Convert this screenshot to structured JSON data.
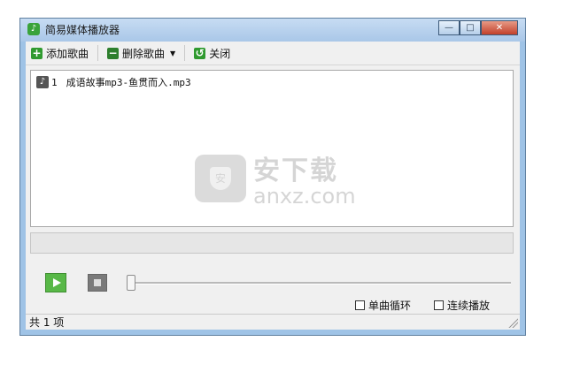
{
  "window": {
    "title": "简易媒体播放器"
  },
  "toolbar": {
    "add_label": "添加歌曲",
    "delete_label": "删除歌曲",
    "close_label": "关闭"
  },
  "playlist": {
    "items": [
      {
        "index": "1",
        "name": "成语故事mp3-鱼贯而入.mp3"
      }
    ]
  },
  "watermark": {
    "text_cn": "安下载",
    "text_en": "anxz.com"
  },
  "controls": {
    "progress": 0,
    "single_loop_label": "单曲循环",
    "continuous_label": "连续播放"
  },
  "status": {
    "text": "共 1 项"
  },
  "colors": {
    "accent_green": "#58b847",
    "title_bar": "#a9c7e8"
  }
}
